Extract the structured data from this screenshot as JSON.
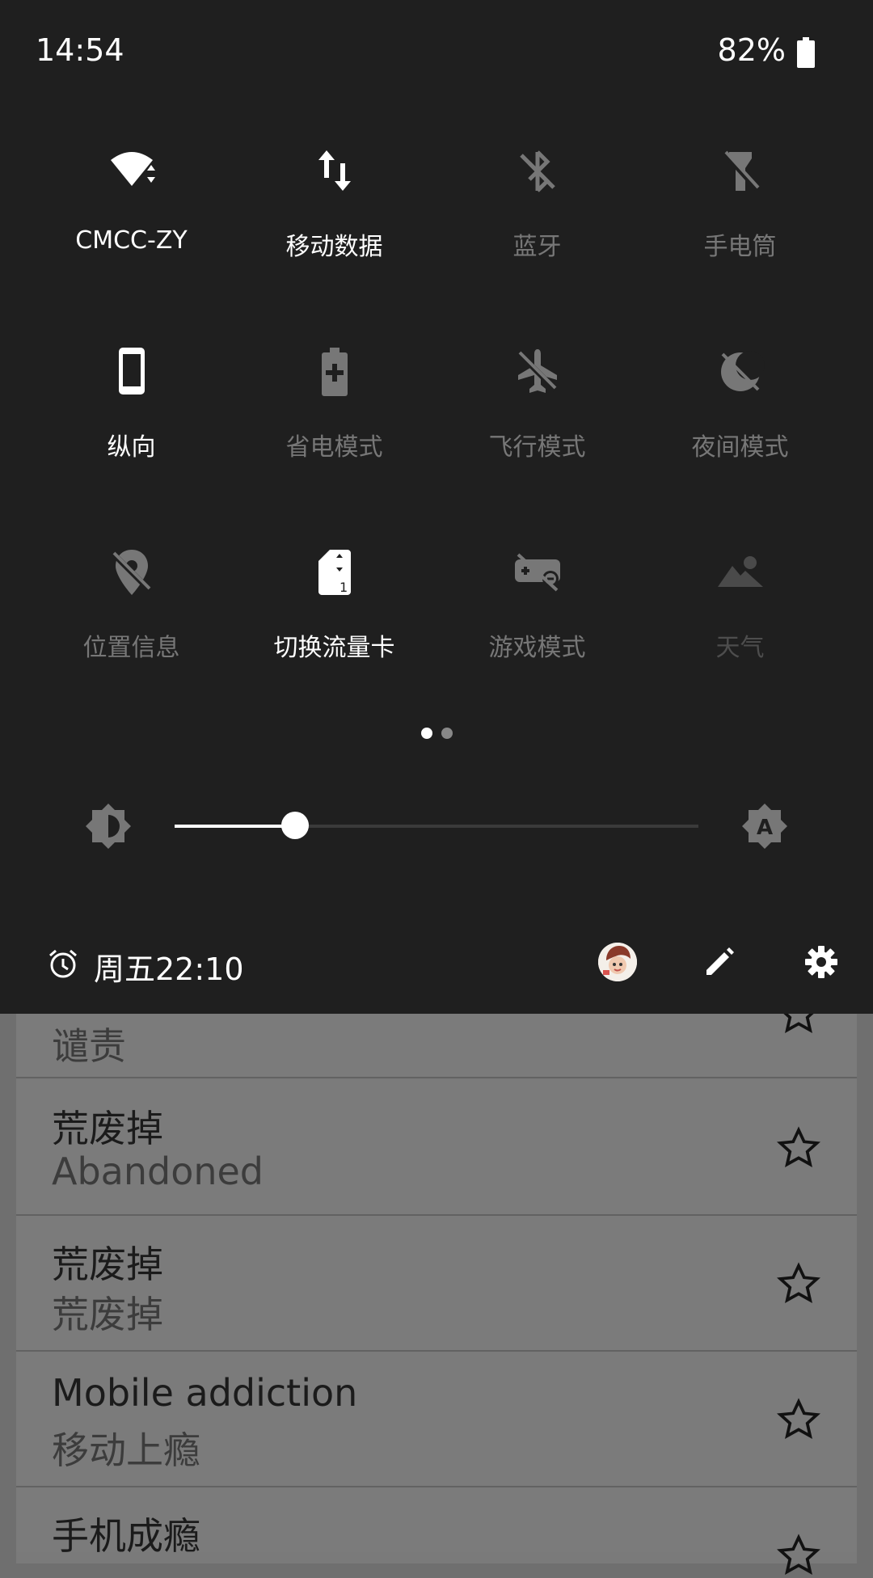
{
  "status_bar": {
    "time": "14:54",
    "battery_percent": "82%",
    "battery_icon": "battery-icon"
  },
  "quick_settings": {
    "tiles": [
      {
        "label": "CMCC-ZY",
        "icon": "wifi-icon",
        "state": "on"
      },
      {
        "label": "移动数据",
        "icon": "mobile-data-icon",
        "state": "on"
      },
      {
        "label": "蓝牙",
        "icon": "bluetooth-off-icon",
        "state": "off"
      },
      {
        "label": "手电筒",
        "icon": "flashlight-off-icon",
        "state": "off"
      },
      {
        "label": "纵向",
        "icon": "portrait-icon",
        "state": "on"
      },
      {
        "label": "省电模式",
        "icon": "battery-saver-icon",
        "state": "off"
      },
      {
        "label": "飞行模式",
        "icon": "airplane-off-icon",
        "state": "off"
      },
      {
        "label": "夜间模式",
        "icon": "night-mode-off-icon",
        "state": "off"
      },
      {
        "label": "位置信息",
        "icon": "location-off-icon",
        "state": "off"
      },
      {
        "label": "切换流量卡",
        "icon": "sim-switch-icon",
        "state": "on"
      },
      {
        "label": "游戏模式",
        "icon": "game-mode-icon",
        "state": "off"
      },
      {
        "label": "天气",
        "icon": "weather-icon",
        "state": "faded"
      }
    ],
    "page_indicator": {
      "pages": 2,
      "current": 1
    }
  },
  "brightness": {
    "level": 0.23,
    "min_icon": "brightness-low-icon",
    "auto_icon": "brightness-auto-icon"
  },
  "footer": {
    "alarm_text": "周五22:10",
    "alarm_icon": "alarm-icon",
    "avatar_icon": "user-avatar",
    "edit_icon": "edit-icon",
    "settings_icon": "settings-icon"
  },
  "background_list": {
    "items": [
      {
        "primary": "",
        "secondary": "谴责"
      },
      {
        "primary": "荒废掉",
        "secondary": "Abandoned"
      },
      {
        "primary": "荒废掉",
        "secondary": "荒废掉"
      },
      {
        "primary": "Mobile addiction",
        "secondary": "移动上瘾"
      },
      {
        "primary": "手机成瘾",
        "secondary": ""
      }
    ]
  },
  "colors": {
    "shade_bg": "#1f1f1f",
    "tile_on": "#ffffff",
    "tile_off": "#777777",
    "list_bg": "#7b7b7b"
  }
}
